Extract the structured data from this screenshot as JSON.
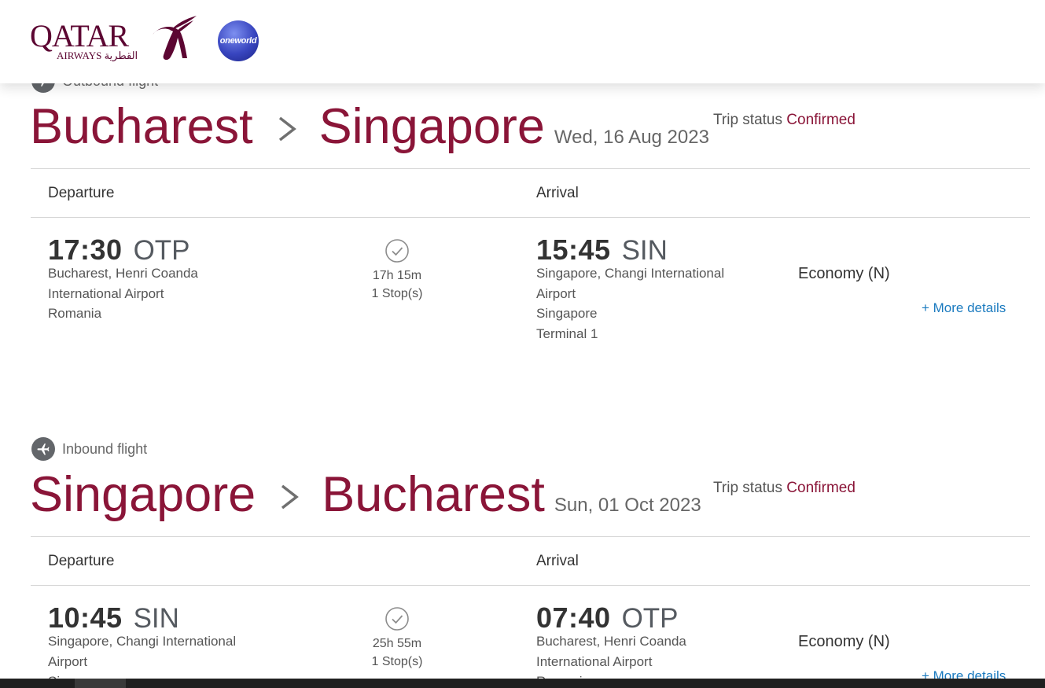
{
  "header": {
    "logo_text": "QATAR",
    "logo_sub": "AIRWAYS القطرية",
    "alliance": "oneworld"
  },
  "flights": [
    {
      "label": "Outbound flight",
      "origin_city": "Bucharest",
      "destination_city": "Singapore",
      "date": "Wed, 16 Aug 2023",
      "trip_status_label": "Trip status",
      "trip_status_value": "Confirmed",
      "departure_header": "Departure",
      "arrival_header": "Arrival",
      "departure": {
        "time": "17:30",
        "code": "OTP",
        "lines": [
          "Bucharest, Henri Coanda",
          "International Airport",
          "Romania"
        ]
      },
      "duration": "17h 15m",
      "stops": "1 Stop(s)",
      "arrival": {
        "time": "15:45",
        "code": "SIN",
        "lines": [
          "Singapore, Changi International",
          "Airport",
          "Singapore",
          "Terminal 1"
        ]
      },
      "cabin": "Economy (N)",
      "more_details": "+ More details"
    },
    {
      "label": "Inbound flight",
      "origin_city": "Singapore",
      "destination_city": "Bucharest",
      "date": "Sun, 01 Oct 2023",
      "trip_status_label": "Trip status",
      "trip_status_value": "Confirmed",
      "departure_header": "Departure",
      "arrival_header": "Arrival",
      "departure": {
        "time": "10:45",
        "code": "SIN",
        "lines": [
          "Singapore, Changi International",
          "Airport",
          "Singapore"
        ]
      },
      "duration": "25h 55m",
      "stops": "1 Stop(s)",
      "arrival": {
        "time": "07:40",
        "code": "OTP",
        "lines": [
          "Bucharest, Henri Coanda",
          "International Airport",
          "Romania"
        ]
      },
      "cabin": "Economy (N)",
      "more_details": "+ More details"
    }
  ],
  "colors": {
    "brand": "#8a1538",
    "link": "#1a7abf",
    "header_logo": "#5c0632"
  }
}
